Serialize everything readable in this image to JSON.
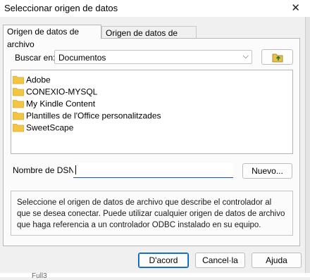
{
  "window": {
    "title": "Seleccionar origen de datos",
    "close_glyph": "✕"
  },
  "tabs": [
    {
      "label": "Origen de datos de archivo",
      "active": true
    },
    {
      "label": "Origen de datos de equipo",
      "active": false
    }
  ],
  "look_in": {
    "label": "Buscar en:",
    "value": "Documentos",
    "up_icon": "folder-up-icon"
  },
  "files": [
    {
      "name": "Adobe",
      "icon": "folder-icon"
    },
    {
      "name": "CONEXIO-MYSQL",
      "icon": "folder-icon"
    },
    {
      "name": "My Kindle Content",
      "icon": "folder-icon"
    },
    {
      "name": "Plantilles de l'Office personalitzades",
      "icon": "folder-icon"
    },
    {
      "name": "SweetScape",
      "icon": "folder-icon"
    }
  ],
  "dsn": {
    "label": "Nombre de DSN:",
    "value": "",
    "new_button": "Nuevo..."
  },
  "description": "Seleccione el origen de datos de archivo que describe el controlador al que se desea conectar. Puede utilizar cualquier origen de datos de archivo que haga referencia a un controlador ODBC instalado en su equipo.",
  "buttons": {
    "ok": "D'acord",
    "cancel": "Cancel·la",
    "help": "Ajuda"
  },
  "background_peek": "Full3",
  "colors": {
    "folder": "#f4c543",
    "accent": "#005fb8"
  }
}
